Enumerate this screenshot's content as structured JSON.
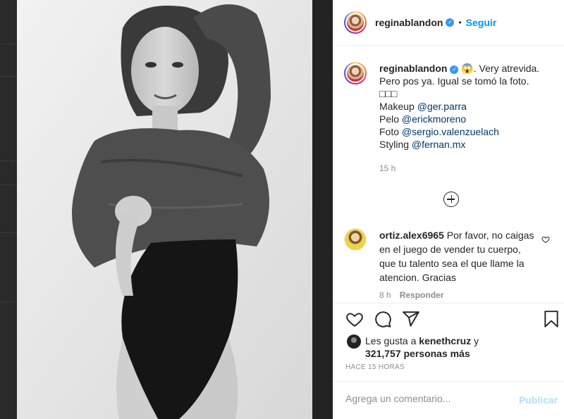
{
  "post": {
    "username": "reginablandon",
    "follow_label": "Seguir",
    "separator": "•",
    "caption": {
      "username": "reginablandon",
      "lines": [
        "😱. Very atrevida.",
        "Pero pos ya. Igual se tomó la foto.",
        "□□□"
      ],
      "credits": [
        {
          "label": "Makeup ",
          "mention": "@ger.parra"
        },
        {
          "label": "Pelo ",
          "mention": "@erickmoreno"
        },
        {
          "label": "Foto ",
          "mention": "@sergio.valenzuelach"
        },
        {
          "label": "Styling ",
          "mention": "@fernan.mx"
        }
      ],
      "time": "15 h"
    },
    "comment": {
      "username": "ortiz.alex6965",
      "text": "Por favor, no caigas en el juego de vender tu cuerpo, que tu talento sea el que llame la atencion. Gracias",
      "time": "8 h",
      "reply_label": "Responder"
    },
    "likes": {
      "prefix": "Les gusta a ",
      "user": "kenethcruz",
      "suffix": " y",
      "count_text": "321,757 personas más"
    },
    "posted": "HACE 15 HORAS",
    "comment_placeholder": "Agrega un comentario...",
    "publish_label": "Publicar"
  },
  "colors": {
    "accent": "#0095f6",
    "mention": "#00376b",
    "muted": "#8e8e8e",
    "publish_disabled": "#b2dffc"
  },
  "icons": [
    "verified-badge-icon",
    "load-more-comments-icon",
    "heart-icon",
    "comment-icon",
    "share-icon",
    "save-bookmark-icon"
  ]
}
